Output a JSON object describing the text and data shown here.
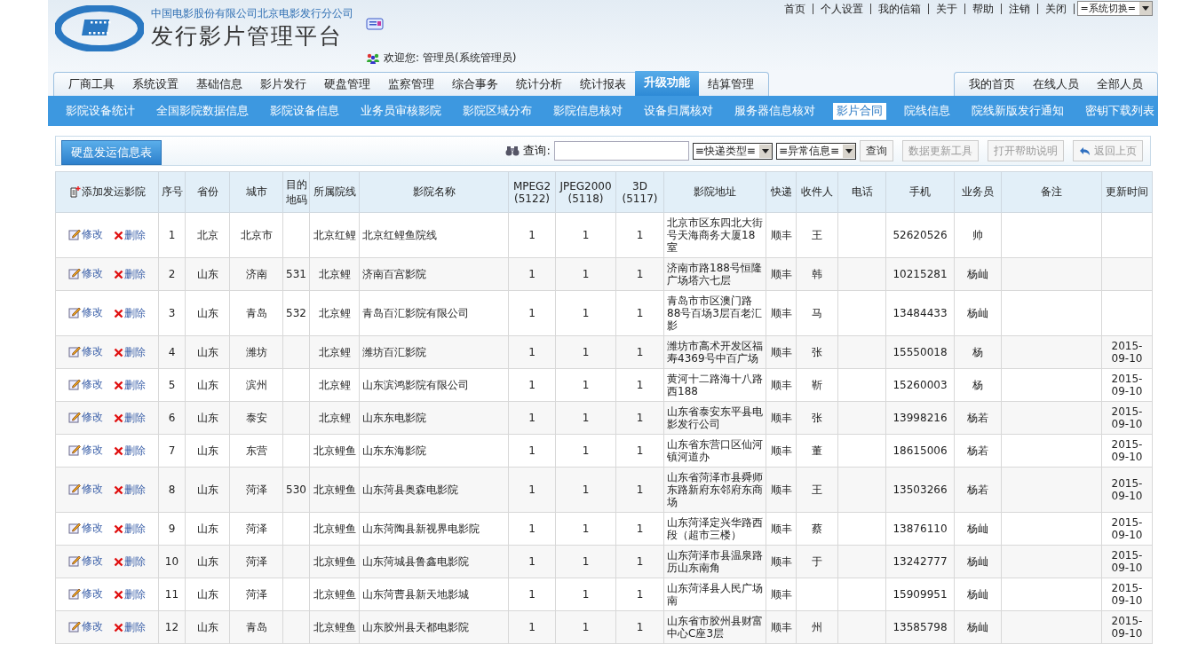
{
  "header": {
    "company": "中国电影股份有限公司北京电影发行分公司",
    "title": "发行影片管理平台",
    "welcome": "欢迎您:",
    "user": "管理员(系统管理员)",
    "top_links": [
      "首页",
      "个人设置",
      "我的信箱",
      "关于",
      "帮助",
      "注销",
      "关闭"
    ],
    "system_switch": "=系统切换="
  },
  "main_tabs": [
    {
      "label": "厂商工具",
      "selected": false
    },
    {
      "label": "系统设置",
      "selected": false
    },
    {
      "label": "基础信息",
      "selected": false
    },
    {
      "label": "影片发行",
      "selected": false
    },
    {
      "label": "硬盘管理",
      "selected": false
    },
    {
      "label": "监察管理",
      "selected": false
    },
    {
      "label": "综合事务",
      "selected": false
    },
    {
      "label": "统计分析",
      "selected": false
    },
    {
      "label": "统计报表",
      "selected": false
    },
    {
      "label": "升级功能",
      "selected": true
    },
    {
      "label": "结算管理",
      "selected": false
    }
  ],
  "right_tabs": [
    "我的首页",
    "在线人员",
    "全部人员"
  ],
  "sub_menu": [
    {
      "label": "影院设备统计",
      "selected": false
    },
    {
      "label": "全国影院数据信息",
      "selected": false
    },
    {
      "label": "影院设备信息",
      "selected": false
    },
    {
      "label": "业务员审核影院",
      "selected": false
    },
    {
      "label": "影院区域分布",
      "selected": false
    },
    {
      "label": "影院信息核对",
      "selected": false
    },
    {
      "label": "设备归属核对",
      "selected": false
    },
    {
      "label": "服务器信息核对",
      "selected": false
    },
    {
      "label": "影片合同",
      "selected": true
    },
    {
      "label": "院线信息",
      "selected": false
    },
    {
      "label": "院线新版发行通知",
      "selected": false
    },
    {
      "label": "密钥下载列表",
      "selected": false
    }
  ],
  "toolbar": {
    "panel_tab": "硬盘发运信息表",
    "search_label": "查询:",
    "express_select": "≡快递类型≡",
    "exception_select": "≡异常信息≡",
    "search_button": "查询",
    "buttons": [
      {
        "label": "数据更新工具",
        "disabled": true,
        "kind": "plain"
      },
      {
        "label": "打开帮助说明",
        "disabled": true,
        "kind": "plain"
      },
      {
        "label": "返回上页",
        "disabled": true,
        "kind": "back"
      }
    ]
  },
  "table": {
    "add_label": "添加发运影院",
    "columns": [
      "序号",
      "省份",
      "城市",
      "目的地码",
      "所属院线",
      "影院名称",
      "MPEG2 (5122)",
      "JPEG2000 (5118)",
      "3D (5117)",
      "影院地址",
      "快递",
      "收件人",
      "电话",
      "手机",
      "业务员",
      "备注",
      "更新时间"
    ],
    "rows": [
      {
        "edit": "修改",
        "delete": "删除",
        "cells": [
          "1",
          "北京",
          "北京市",
          "",
          "北京红鲤",
          "北京红鲤鱼院线",
          "1",
          "1",
          "1",
          "北京市区东四北大街号天海商务大厦18室",
          "顺丰",
          "王",
          "",
          "52620526",
          "帅",
          "",
          ""
        ]
      },
      {
        "edit": "修改",
        "delete": "删除",
        "cells": [
          "2",
          "山东",
          "济南",
          "531",
          "北京鲤",
          "济南百宫影院",
          "1",
          "1",
          "1",
          "济南市路188号恒隆广场塔六七层",
          "顺丰",
          "韩",
          "",
          "10215281",
          "杨屾",
          "",
          ""
        ]
      },
      {
        "edit": "修改",
        "delete": "删除",
        "cells": [
          "3",
          "山东",
          "青岛",
          "532",
          "北京鲤",
          "青岛百汇影院有限公司",
          "1",
          "1",
          "1",
          "青岛市市区澳门路88号百场3层百老汇影",
          "顺丰",
          "马",
          "",
          "13484433",
          "杨屾",
          "",
          ""
        ]
      },
      {
        "edit": "修改",
        "delete": "删除",
        "cells": [
          "4",
          "山东",
          "潍坊",
          "",
          "北京鲤",
          "潍坊百汇影院",
          "1",
          "1",
          "1",
          "潍坊市高术开发区福寿4369号中百广场",
          "顺丰",
          "张",
          "",
          "15550018",
          "杨",
          "",
          "2015-09-10"
        ]
      },
      {
        "edit": "修改",
        "delete": "删除",
        "cells": [
          "5",
          "山东",
          "滨州",
          "",
          "北京鲤",
          "山东滨鸿影院有限公司",
          "1",
          "1",
          "1",
          "黄河十二路海十八路西188",
          "顺丰",
          "靳",
          "",
          "15260003",
          "杨",
          "",
          "2015-09-10"
        ]
      },
      {
        "edit": "修改",
        "delete": "删除",
        "cells": [
          "6",
          "山东",
          "泰安",
          "",
          "北京鲤",
          "山东东电影院",
          "1",
          "1",
          "1",
          "山东省泰安东平县电影发行公司",
          "顺丰",
          "张",
          "",
          "13998216",
          "杨若",
          "",
          "2015-09-10"
        ]
      },
      {
        "edit": "修改",
        "delete": "删除",
        "cells": [
          "7",
          "山东",
          "东营",
          "",
          "北京鲤鱼",
          "山东东海影院",
          "1",
          "1",
          "1",
          "山东省东营口区仙河镇河道办",
          "顺丰",
          "董",
          "",
          "18615006",
          "杨若",
          "",
          "2015-09-10"
        ]
      },
      {
        "edit": "修改",
        "delete": "删除",
        "cells": [
          "8",
          "山东",
          "菏泽",
          "530",
          "北京鲤鱼",
          "山东菏县奥森电影院",
          "1",
          "1",
          "1",
          "山东省菏泽市县舜师东路新府东邻府东商场",
          "顺丰",
          "王",
          "",
          "13503266",
          "杨若",
          "",
          "2015-09-10"
        ]
      },
      {
        "edit": "修改",
        "delete": "删除",
        "cells": [
          "9",
          "山东",
          "菏泽",
          "",
          "北京鲤鱼",
          "山东菏陶县新视界电影院",
          "1",
          "1",
          "1",
          "山东菏泽定兴华路西段（超市三楼）",
          "顺丰",
          "蔡",
          "",
          "13876110",
          "杨屾",
          "",
          "2015-09-10"
        ]
      },
      {
        "edit": "修改",
        "delete": "删除",
        "cells": [
          "10",
          "山东",
          "菏泽",
          "",
          "北京鲤鱼",
          "山东菏城县鲁鑫电影院",
          "1",
          "1",
          "1",
          "山东菏泽市县温泉路历山东南角",
          "顺丰",
          "于",
          "",
          "13242777",
          "杨屾",
          "",
          "2015-09-10"
        ]
      },
      {
        "edit": "修改",
        "delete": "删除",
        "cells": [
          "11",
          "山东",
          "菏泽",
          "",
          "北京鲤鱼",
          "山东菏曹县新天地影城",
          "1",
          "1",
          "1",
          "山东菏泽县人民广场南",
          "顺丰",
          "",
          "",
          "15909951",
          "杨屾",
          "",
          "2015-09-10"
        ]
      },
      {
        "edit": "修改",
        "delete": "删除",
        "cells": [
          "12",
          "山东",
          "青岛",
          "",
          "北京鲤鱼",
          "山东胶州县天都电影院",
          "1",
          "1",
          "1",
          "山东省市胶州县财富中心C座3层",
          "顺丰",
          "州",
          "",
          "13585798",
          "杨屾",
          "",
          "2015-09-10"
        ]
      }
    ]
  }
}
